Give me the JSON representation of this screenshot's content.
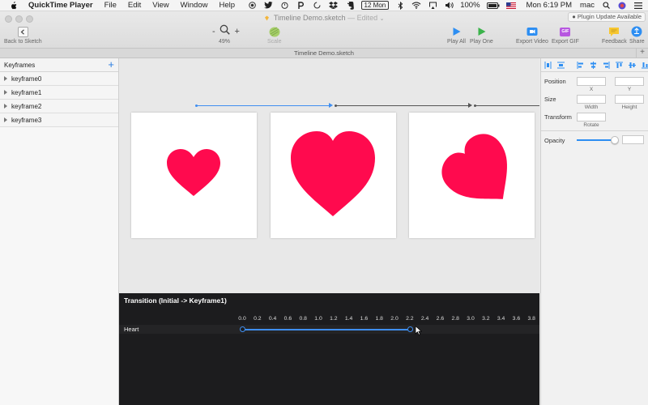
{
  "menubar": {
    "app_name": "QuickTime Player",
    "items": [
      "File",
      "Edit",
      "View",
      "Window",
      "Help"
    ],
    "date_badge": "12 Mon",
    "battery": "100%",
    "clock": "Mon 6:19 PM",
    "user": "mac"
  },
  "window": {
    "title": "Timeline Demo.sketch",
    "edited": "— Edited",
    "plugin_badge": "Plugin Update Available"
  },
  "toolbar": {
    "back_label": "Back to Sketch",
    "zoom_minus": "-",
    "zoom_plus": "+",
    "zoom_value": "49%",
    "scale_label": "Scale",
    "play_all_label": "Play All",
    "play_one_label": "Play One",
    "export_video_label": "Export Video",
    "export_gif_label": "Export GIF",
    "gif_icon_text": "GIF",
    "feedback_label": "Feedback",
    "share_label": "Share"
  },
  "tabbar": {
    "label": "Timeline Demo.sketch",
    "add": "+"
  },
  "keyframes": {
    "header": "Keyframes",
    "add": "+",
    "items": [
      "keyframe0",
      "keyframe1",
      "keyframe2",
      "keyframe3"
    ]
  },
  "inspector": {
    "position_label": "Position",
    "x_label": "X",
    "y_label": "Y",
    "size_label": "Size",
    "width_label": "Width",
    "height_label": "Height",
    "transform_label": "Transform",
    "rotate_label": "Rotate",
    "opacity_label": "Opacity",
    "opacity_value": 0.92
  },
  "timeline": {
    "title": "Transition (Initial -> Keyframe1)",
    "ticks": [
      "0.0",
      "0.2",
      "0.4",
      "0.6",
      "0.8",
      "1.0",
      "1.2",
      "1.4",
      "1.6",
      "1.8",
      "2.0",
      "2.2",
      "2.4",
      "2.6",
      "2.8",
      "3.0",
      "3.2",
      "3.4",
      "3.6",
      "3.8"
    ],
    "rows": [
      {
        "label": "Heart",
        "start": 0.0,
        "end": 2.2
      }
    ]
  },
  "colors": {
    "heart": "#ff0a4e",
    "accent": "#3f8ef0",
    "play_green": "#3ab34a",
    "export_video": "#2d8ef2",
    "export_gif": "#b757e0",
    "feedback": "#f7c730",
    "share": "#2d8ef2",
    "scale": "#a7cf6a"
  }
}
